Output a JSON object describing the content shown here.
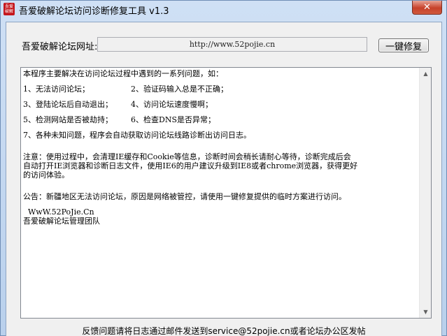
{
  "window": {
    "title": "吾爱破解论坛访问诊断修复工具 v1.3",
    "app_icon_text": "吾爱破解",
    "close_glyph": "✕"
  },
  "form": {
    "url_label": "吾爱破解论坛网址:",
    "url_value": "http://www.52pojie.cn",
    "repair_button_label": "一键修复"
  },
  "log": {
    "intro": "本程序主要解决在访问论坛过程中遇到的一系列问题，如：",
    "items": [
      [
        "1、无法访问论坛；",
        "2、验证码输入总是不正确；"
      ],
      [
        "3、登陆论坛后自动退出；",
        "4、访问论坛速度慢啊；"
      ],
      [
        "5、检测网站是否被劫持；",
        "6、检查DNS是否异常；"
      ]
    ],
    "item7": "7、各种未知问题，程序会自动获取访问论坛线路诊断出访问日志。",
    "notice_lines": [
      "注意：使用过程中，会清理IE缓存和Cookie等信息，诊断时间会稍长请耐心等待，诊断完成后会",
      "自动打开IE浏览器和诊断日志文件，使用IE6的用户建议升级到IE8或者chrome浏览器，获得更好",
      "的访问体验。"
    ],
    "announcement": "公告：新疆地区无法访问论坛，原因是网络被管控，请使用一键修复提供的临时方案进行访问。",
    "signature_site": "  WwW.52PoJie.Cn",
    "signature_team": "吾爱破解论坛管理团队"
  },
  "footer": {
    "text": "反馈问题请将日志通过邮件发送到service@52pojie.cn或者论坛办公区发帖"
  }
}
